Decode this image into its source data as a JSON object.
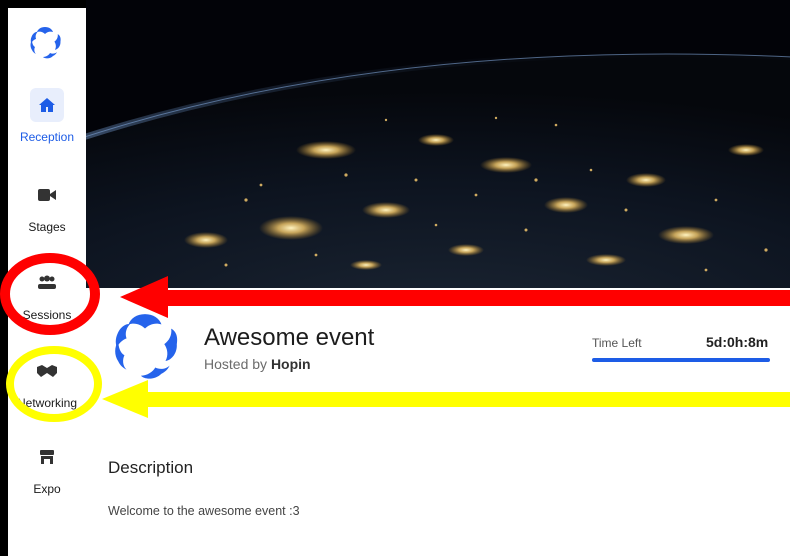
{
  "sidebar": {
    "items": [
      {
        "label": "Reception",
        "icon": "home-icon",
        "active": true
      },
      {
        "label": "Stages",
        "icon": "video-camera-icon",
        "active": false
      },
      {
        "label": "Sessions",
        "icon": "group-icon",
        "active": false
      },
      {
        "label": "Networking",
        "icon": "handshake-icon",
        "active": false
      },
      {
        "label": "Expo",
        "icon": "booth-icon",
        "active": false
      }
    ]
  },
  "event": {
    "title": "Awesome event",
    "hosted_prefix": "Hosted by ",
    "host": "Hopin",
    "time_left_label": "Time Left",
    "time_left_value": "5d:0h:8m",
    "time_left_progress": 1.0
  },
  "description": {
    "heading": "Description",
    "text": "Welcome to the awesome event :3"
  },
  "colors": {
    "accent": "#1d5ce6",
    "annotation_red": "#ff0000",
    "annotation_yellow": "#ffff00"
  }
}
